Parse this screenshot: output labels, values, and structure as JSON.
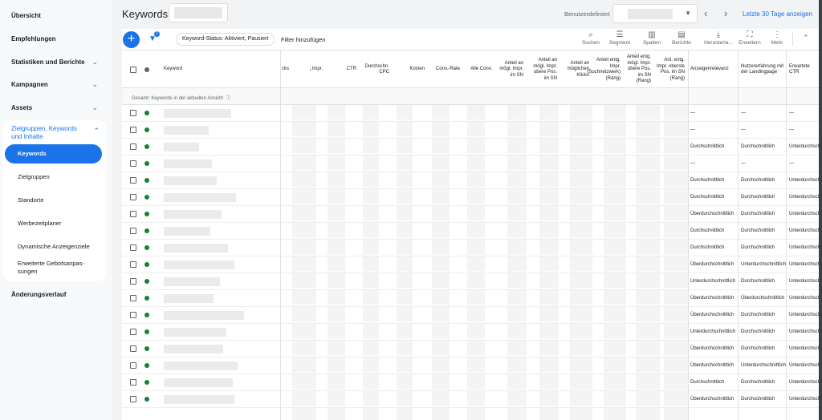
{
  "sidebar": {
    "items": [
      {
        "label": "Übersicht",
        "expandable": false
      },
      {
        "label": "Empfehlungen",
        "expandable": false
      },
      {
        "label": "Statistiken und Berichte",
        "expandable": true
      },
      {
        "label": "Kampagnen",
        "expandable": true
      },
      {
        "label": "Assets",
        "expandable": true
      }
    ],
    "group": {
      "label": "Zielgruppen, Keywords und Inhalte",
      "active": "Keywords",
      "items": [
        "Zielgruppen",
        "Standorte",
        "Werbezeitplaner",
        "Dynamische Anzeigenziele",
        "Erweiterte Gebotsanpas-sungen"
      ]
    },
    "bottom": "Änderungsverlauf"
  },
  "header": {
    "title": "Keywords",
    "date_type": "Benutzerdefiniert",
    "date_range": "Letzte 30 Tage anzeigen",
    "prev_icon": "chevron-left-icon",
    "next_icon": "chevron-right-icon"
  },
  "toolbar": {
    "filter_badge": "1",
    "status_chip": "Keyword-Status: Aktiviert, Pausiert",
    "add_filter": "Filter hinzufügen",
    "tools": [
      {
        "label": "Suchen",
        "icon": "search-icon",
        "glyph": "⌕"
      },
      {
        "label": "Segment",
        "icon": "segment-icon",
        "glyph": "☰"
      },
      {
        "label": "Spalten",
        "icon": "columns-icon",
        "glyph": "▥"
      },
      {
        "label": "Berichte",
        "icon": "reports-icon",
        "glyph": "▤"
      },
      {
        "label": "Herunterla...",
        "icon": "download-icon",
        "glyph": "⤓"
      },
      {
        "label": "Erweitern",
        "icon": "expand-icon",
        "glyph": "⛶"
      },
      {
        "label": "Mehr",
        "icon": "more-icon",
        "glyph": "⋮"
      }
    ]
  },
  "table": {
    "columns": [
      "Keyword",
      "cks",
      "Impr.",
      "CTR",
      "Durchschn. CPC",
      "Kosten",
      "Conv.-Rate",
      "Alle Conv.",
      "Anteil an mögl. Impr. im SN",
      "Anteil an mögl. Impr. obere Pos. im SN",
      "Anteil an möglichen Klicks",
      "Anteil entg. Impr. (Suchnetzwerk) (Rang)",
      "Anteil entg. mögl. Impr. obere Pos. im SN (Rang)",
      "Ant. entg. Impr. oberste Pos. im SN (Rang)",
      "Anzeigenrelevanz",
      "Nutzererfahrung mit der Landingpage",
      "Erwartete CTR"
    ],
    "total_label": "Gesamt: Keywords in der aktuellen Ansicht",
    "status_color": "#188038",
    "rows": [
      [
        "—",
        "—",
        "—"
      ],
      [
        "—",
        "—",
        "—"
      ],
      [
        "Durchschnittlich",
        "Durchschnittlich",
        "Unterdurchschnittl"
      ],
      [
        "—",
        "—",
        "—"
      ],
      [
        "Durchschnittlich",
        "Durchschnittlich",
        "Unterdurchschnittl"
      ],
      [
        "Durchschnittlich",
        "Durchschnittlich",
        "Unterdurchschnittl"
      ],
      [
        "Überdurchschnittlich",
        "Durchschnittlich",
        "Unterdurchschnittl"
      ],
      [
        "Durchschnittlich",
        "Durchschnittlich",
        "Unterdurchschnittl"
      ],
      [
        "Durchschnittlich",
        "Durchschnittlich",
        "Unterdurchschnittl"
      ],
      [
        "Überdurchschnittlich",
        "Unterdurchschnittlich",
        "Unterdurchschnittl"
      ],
      [
        "Unterdurchschnittlich",
        "Durchschnittlich",
        "Unterdurchschnittl"
      ],
      [
        "Überdurchschnittlich",
        "Überdurchschnittlich",
        "Unterdurchschnittl"
      ],
      [
        "Überdurchschnittlich",
        "Durchschnittlich",
        "Unterdurchschnittl"
      ],
      [
        "Unterdurchschnittlich",
        "Durchschnittlich",
        "Unterdurchschnittl"
      ],
      [
        "Überdurchschnittlich",
        "Durchschnittlich",
        "Unterdurchschnittl"
      ],
      [
        "Überdurchschnittlich",
        "Unterdurchschnittlich",
        "Unterdurchschnittl"
      ],
      [
        "Durchschnittlich",
        "Durchschnittlich",
        "Unterdurchschnittl"
      ],
      [
        "Überdurchschnittlich",
        "Durchschnittlich",
        "Unterdurchschnittl"
      ]
    ]
  },
  "colors": {
    "accent": "#1a73e8",
    "status_green": "#188038"
  }
}
